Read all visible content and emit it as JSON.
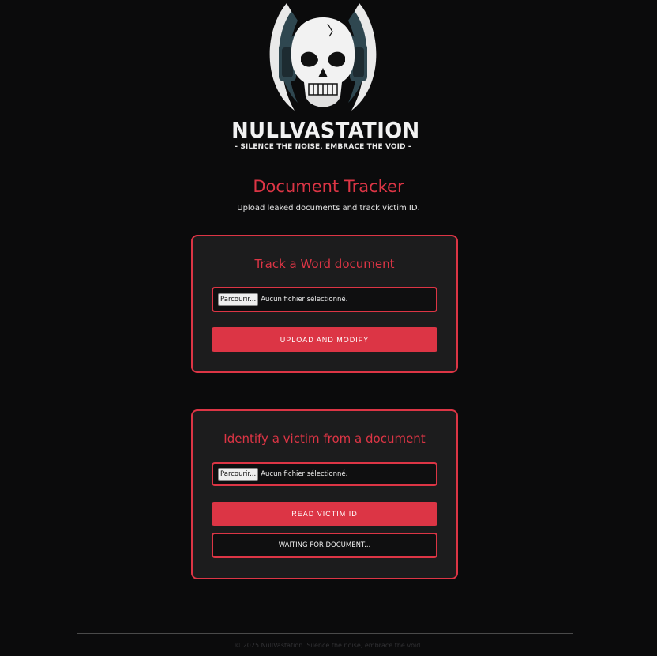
{
  "brand": {
    "name": "NULLVASTATION",
    "tagline": "- SILENCE THE NOISE, EMBRACE THE VOID -"
  },
  "header": {
    "title": "Document Tracker",
    "subtitle": "Upload leaked documents and track victim ID."
  },
  "track_card": {
    "heading": "Track a Word document",
    "browse_label": "Parcourir...",
    "file_status": "Aucun fichier sélectionné.",
    "button_label": "UPLOAD AND MODIFY"
  },
  "identify_card": {
    "heading": "Identify a victim from a document",
    "browse_label": "Parcourir...",
    "file_status": "Aucun fichier sélectionné.",
    "button_label": "READ VICTIM ID",
    "result_text": "WAITING FOR DOCUMENT..."
  },
  "footer": {
    "text": "© 2025 NullVastation. Silence the noise, embrace the void."
  },
  "colors": {
    "accent": "#dc3545",
    "background": "#0b0b0c",
    "card": "#1c1c1d"
  },
  "icons": {
    "logo": "skull-headphones-logo"
  }
}
